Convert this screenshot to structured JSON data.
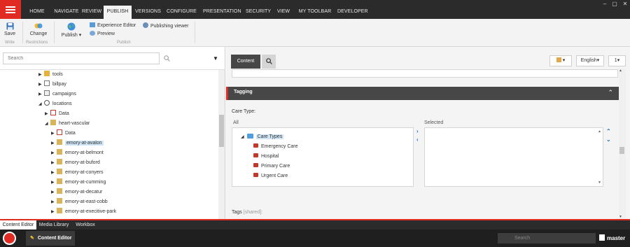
{
  "menu": {
    "tabs": [
      "HOME",
      "NAVIGATE",
      "REVIEW",
      "PUBLISH",
      "VERSIONS",
      "CONFIGURE",
      "PRESENTATION",
      "SECURITY",
      "VIEW",
      "MY TOOLBAR",
      "DEVELOPER"
    ],
    "active_tab": "PUBLISH"
  },
  "ribbon": {
    "save_label": "Save",
    "write_group": "Write",
    "change_label": "Change",
    "restrictions_group": "Restrictions",
    "publish_label": "Publish",
    "experience_editor_label": "Experience Editor",
    "preview_label": "Preview",
    "publishing_viewer_label": "Publishing viewer",
    "publish_group": "Publish"
  },
  "tree": {
    "search_placeholder": "Search",
    "nodes": [
      {
        "label": "tools",
        "toggle": "▶",
        "icon": "folder-icon",
        "selected": false
      },
      {
        "label": "billpay",
        "toggle": "▶",
        "icon": "page-icon",
        "selected": false
      },
      {
        "label": "campaigns",
        "toggle": "▶",
        "icon": "page-icon",
        "selected": false
      },
      {
        "label": "locations",
        "toggle": "◢",
        "icon": "search-icon",
        "selected": false
      },
      {
        "label": "Data",
        "toggle": "▶",
        "icon": "data-icon",
        "selected": false
      },
      {
        "label": "heart-vascular",
        "toggle": "◢",
        "icon": "item-icon",
        "selected": false
      },
      {
        "label": "Data",
        "toggle": "▶",
        "icon": "data-icon",
        "selected": false
      },
      {
        "label": "emory-at-avalon",
        "toggle": "▶",
        "icon": "item-icon",
        "selected": true
      },
      {
        "label": "emory-at-belmont",
        "toggle": "▶",
        "icon": "item-icon",
        "selected": false
      },
      {
        "label": "emory-at-buford",
        "toggle": "▶",
        "icon": "item-icon",
        "selected": false
      },
      {
        "label": "emory-at-conyers",
        "toggle": "▶",
        "icon": "item-icon",
        "selected": false
      },
      {
        "label": "emory-at-cumming",
        "toggle": "▶",
        "icon": "item-icon",
        "selected": false
      },
      {
        "label": "emory-at-decatur",
        "toggle": "▶",
        "icon": "item-icon",
        "selected": false
      },
      {
        "label": "emory-at-east-cobb",
        "toggle": "▶",
        "icon": "item-icon",
        "selected": false
      },
      {
        "label": "emory-at-execitive-park",
        "toggle": "▶",
        "icon": "item-icon",
        "selected": false
      }
    ]
  },
  "editor": {
    "content_tab": "Content",
    "language": "English",
    "version": "1",
    "section_title": "Tagging",
    "care_type_label": "Care Type:",
    "all_label": "All",
    "selected_label": "Selected",
    "root_item": "Care Types",
    "care_types": [
      "Emergency Care",
      "Hospital",
      "Primary Care",
      "Urgent Care"
    ],
    "tags_label": "Tags",
    "tags_suffix": "[shared]:"
  },
  "bottom_tabs": [
    "Content Editor",
    "Media Library",
    "Workbox"
  ],
  "bottom_active": "Content Editor",
  "taskbar": {
    "app_label": "Content Editor",
    "search_placeholder": "Search",
    "database": "master"
  },
  "colors": {
    "accent": "#e02a22",
    "dark": "#2b2b2b",
    "link_blue": "#1e6fc4"
  }
}
